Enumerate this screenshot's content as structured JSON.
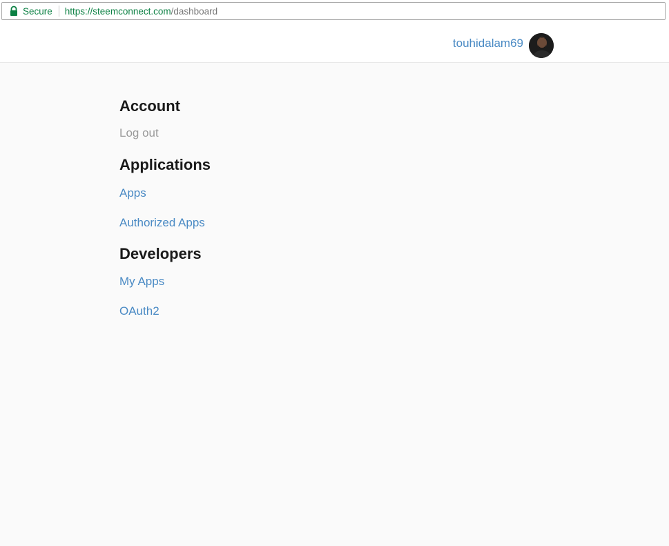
{
  "browser": {
    "secure_label": "Secure",
    "url_scheme_host": "https://steemconnect.com",
    "url_path": "/dashboard"
  },
  "header": {
    "username": "touhidalam69"
  },
  "menu": {
    "account": {
      "title": "Account",
      "items": [
        {
          "label": "Log out"
        }
      ]
    },
    "applications": {
      "title": "Applications",
      "items": [
        {
          "label": "Apps"
        },
        {
          "label": "Authorized Apps"
        }
      ]
    },
    "developers": {
      "title": "Developers",
      "items": [
        {
          "label": "My Apps"
        },
        {
          "label": "OAuth2"
        }
      ]
    }
  },
  "colors": {
    "link": "#4a8ac4",
    "muted_link": "#999999",
    "secure_green": "#0b8043",
    "page_bg": "#fafafa"
  }
}
